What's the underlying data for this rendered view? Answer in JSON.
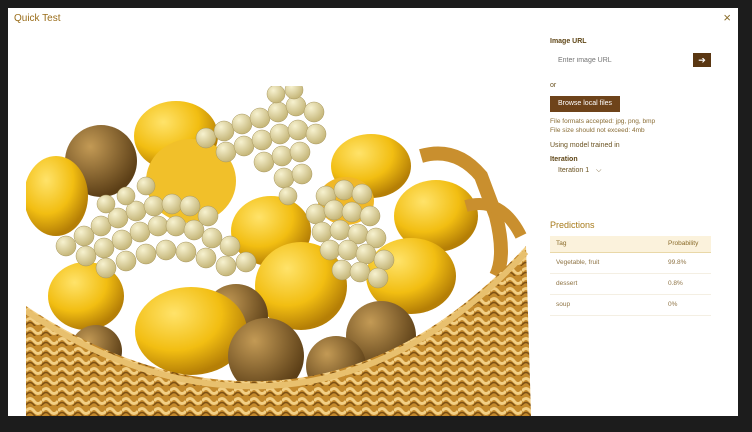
{
  "dialog": {
    "title": "Quick Test",
    "close_icon": "×"
  },
  "image_panel": {
    "description": "fruit-basket-image"
  },
  "right_panel": {
    "image_url_label": "Image URL",
    "url_placeholder": "Enter image URL",
    "submit_arrow": "➔",
    "or_label": "or",
    "browse_label": "Browse local files",
    "formats_note": "File formats accepted: jpg, png, bmp",
    "size_note": "File size should not exceed: 4mb",
    "using_model_label": "Using model trained in",
    "iteration_label": "Iteration",
    "iteration_value": "Iteration 1",
    "iteration_chevron": "⌵"
  },
  "predictions": {
    "title": "Predictions",
    "headers": {
      "tag": "Tag",
      "probability": "Probability"
    },
    "rows": [
      {
        "tag": "Vegetable, fruit",
        "probability": "99.8%"
      },
      {
        "tag": "dessert",
        "probability": "0.8%"
      },
      {
        "tag": "soup",
        "probability": "0%"
      }
    ]
  },
  "colors": {
    "accent": "#6e431a",
    "title": "#9a6d1a",
    "header_bg": "#fbf2dc"
  }
}
